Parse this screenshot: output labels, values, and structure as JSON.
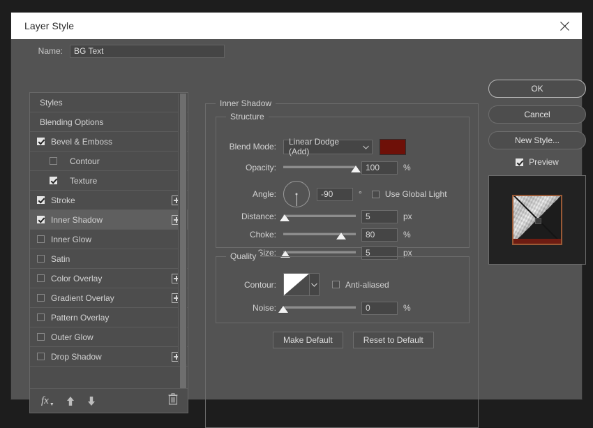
{
  "window": {
    "title": "Layer Style",
    "close_icon": "close-icon"
  },
  "name_field": {
    "label": "Name:",
    "value": "BG Text",
    "placeholder": ""
  },
  "sidebar": {
    "items": [
      {
        "label": "Styles",
        "type": "plain",
        "checkbox": null,
        "plus": false,
        "selected": false
      },
      {
        "label": "Blending Options",
        "type": "plain",
        "checkbox": null,
        "plus": false,
        "selected": false
      },
      {
        "label": "Bevel & Emboss",
        "type": "checkbox",
        "checkbox": true,
        "plus": false,
        "selected": false
      },
      {
        "label": "Contour",
        "type": "indent",
        "checkbox": false,
        "plus": false,
        "selected": false
      },
      {
        "label": "Texture",
        "type": "indent",
        "checkbox": true,
        "plus": false,
        "selected": false
      },
      {
        "label": "Stroke",
        "type": "checkbox",
        "checkbox": true,
        "plus": true,
        "selected": false
      },
      {
        "label": "Inner Shadow",
        "type": "checkbox",
        "checkbox": true,
        "plus": true,
        "selected": true
      },
      {
        "label": "Inner Glow",
        "type": "checkbox",
        "checkbox": false,
        "plus": false,
        "selected": false
      },
      {
        "label": "Satin",
        "type": "checkbox",
        "checkbox": false,
        "plus": false,
        "selected": false
      },
      {
        "label": "Color Overlay",
        "type": "checkbox",
        "checkbox": false,
        "plus": true,
        "selected": false
      },
      {
        "label": "Gradient Overlay",
        "type": "checkbox",
        "checkbox": false,
        "plus": true,
        "selected": false
      },
      {
        "label": "Pattern Overlay",
        "type": "checkbox",
        "checkbox": false,
        "plus": false,
        "selected": false
      },
      {
        "label": "Outer Glow",
        "type": "checkbox",
        "checkbox": false,
        "plus": false,
        "selected": false
      },
      {
        "label": "Drop Shadow",
        "type": "checkbox",
        "checkbox": false,
        "plus": true,
        "selected": false
      }
    ],
    "toolbar": {
      "fx_label": "fx",
      "fx_icon": "fx-icon",
      "move_up_icon": "arrow-up-icon",
      "move_down_icon": "arrow-down-icon",
      "delete_icon": "trash-icon"
    }
  },
  "panel": {
    "title": "Inner Shadow",
    "structure": {
      "title": "Structure",
      "blend_mode": {
        "label": "Blend Mode:",
        "value": "Linear Dodge (Add)",
        "color": "#6e1008"
      },
      "opacity": {
        "label": "Opacity:",
        "value": "100",
        "unit": "%",
        "percent": 100
      },
      "angle": {
        "label": "Angle:",
        "value": "-90",
        "unit": "°",
        "degrees": -90
      },
      "use_global_light": {
        "label": "Use Global Light",
        "checked": false
      },
      "distance": {
        "label": "Distance:",
        "value": "5",
        "unit": "px",
        "percent": 2
      },
      "choke": {
        "label": "Choke:",
        "value": "80",
        "unit": "%",
        "percent": 80
      },
      "size": {
        "label": "Size:",
        "value": "5",
        "unit": "px",
        "percent": 3
      }
    },
    "quality": {
      "title": "Quality",
      "contour": {
        "label": "Contour:",
        "preview": "linear-contour-icon"
      },
      "anti_aliased": {
        "label": "Anti-aliased",
        "checked": false
      },
      "noise": {
        "label": "Noise:",
        "value": "0",
        "unit": "%",
        "percent": 0
      }
    },
    "buttons": {
      "make_default": "Make Default",
      "reset_to_default": "Reset to Default"
    }
  },
  "actions": {
    "ok": "OK",
    "cancel": "Cancel",
    "new_style": "New Style...",
    "preview": {
      "label": "Preview",
      "checked": true
    }
  }
}
